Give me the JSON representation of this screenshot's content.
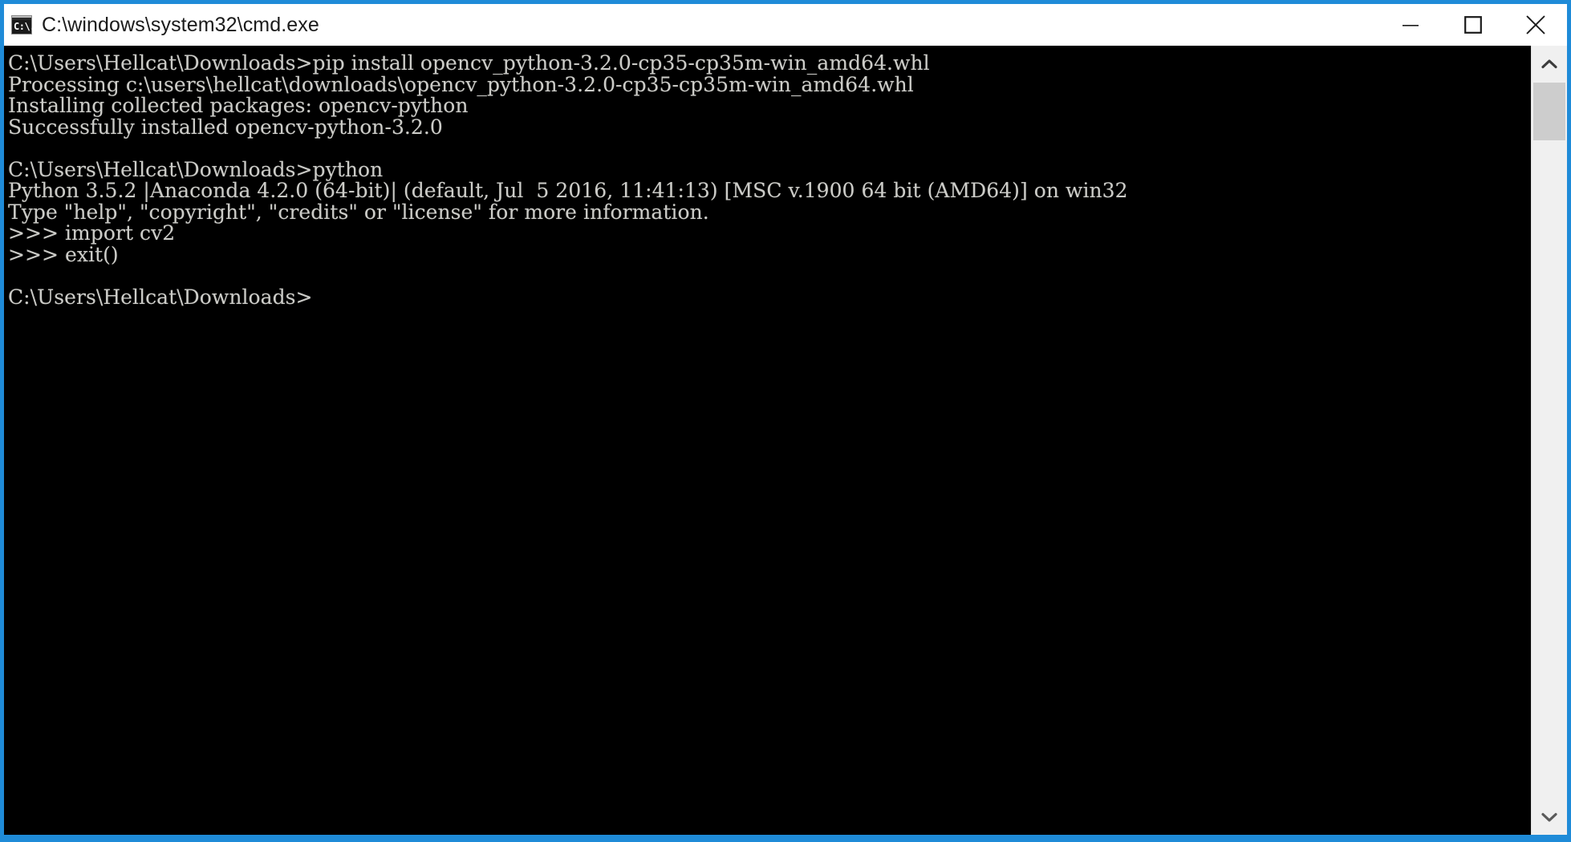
{
  "window": {
    "title": "C:\\windows\\system32\\cmd.exe",
    "icon": "cmd-console-icon",
    "icon_glyph": "C:\\.",
    "border_color": "#1f8bd8",
    "titlebar_bg": "#ffffff",
    "titlebar_text_color": "#1b1b1b"
  },
  "controls": {
    "minimize_label": "Minimize",
    "maximize_label": "Maximize",
    "close_label": "Close"
  },
  "terminal": {
    "background_color": "#000000",
    "text_color": "#ccccc8",
    "content": "C:\\Users\\Hellcat\\Downloads>pip install opencv_python-3.2.0-cp35-cp35m-win_amd64.whl\nProcessing c:\\users\\hellcat\\downloads\\opencv_python-3.2.0-cp35-cp35m-win_amd64.whl\nInstalling collected packages: opencv-python\nSuccessfully installed opencv-python-3.2.0\n\nC:\\Users\\Hellcat\\Downloads>python\nPython 3.5.2 |Anaconda 4.2.0 (64-bit)| (default, Jul  5 2016, 11:41:13) [MSC v.1900 64 bit (AMD64)] on win32\nType \"help\", \"copyright\", \"credits\" or \"license\" for more information.\n>>> import cv2\n>>> exit()\n\nC:\\Users\\Hellcat\\Downloads>",
    "lines": [
      "C:\\Users\\Hellcat\\Downloads>pip install opencv_python-3.2.0-cp35-cp35m-win_amd64.whl",
      "Processing c:\\users\\hellcat\\downloads\\opencv_python-3.2.0-cp35-cp35m-win_amd64.whl",
      "Installing collected packages: opencv-python",
      "Successfully installed opencv-python-3.2.0",
      "",
      "C:\\Users\\Hellcat\\Downloads>python",
      "Python 3.5.2 |Anaconda 4.2.0 (64-bit)| (default, Jul  5 2016, 11:41:13) [MSC v.1900 64 bit (AMD64)] on win32",
      "Type \"help\", \"copyright\", \"credits\" or \"license\" for more information.",
      ">>> import cv2",
      ">>> exit()",
      "",
      "C:\\Users\\Hellcat\\Downloads>"
    ]
  },
  "scrollbar": {
    "up_arrow": "chevron-up-icon",
    "down_arrow": "chevron-down-icon",
    "track_color": "#f0f0f0",
    "thumb_color": "#cdcdcd"
  }
}
